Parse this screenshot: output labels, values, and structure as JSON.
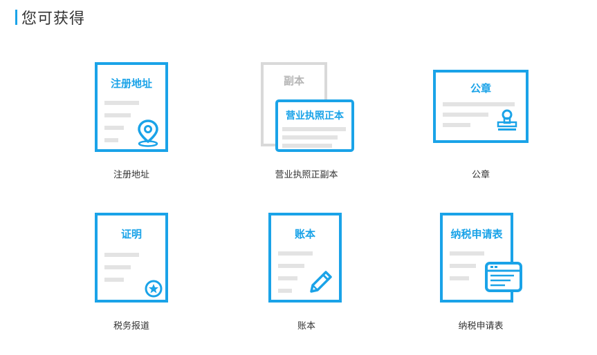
{
  "header": {
    "title": "您可获得"
  },
  "items": [
    {
      "card_title": "注册地址",
      "caption": "注册地址",
      "icon": "location-pin-icon"
    },
    {
      "back_title": "副本",
      "card_title": "营业执照正本",
      "caption": "营业执照正副本"
    },
    {
      "card_title": "公章",
      "caption": "公章",
      "icon": "stamp-icon"
    },
    {
      "card_title": "证明",
      "caption": "税务报道",
      "icon": "star-badge-icon"
    },
    {
      "card_title": "账本",
      "caption": "账本",
      "icon": "pencil-icon"
    },
    {
      "card_title": "纳税申请表",
      "caption": "纳税申请表",
      "icon": "form-window-icon"
    }
  ],
  "colors": {
    "accent": "#1aa3e8",
    "line": "#e3e3e3",
    "gray": "#d9d9d9",
    "text": "#333333"
  }
}
